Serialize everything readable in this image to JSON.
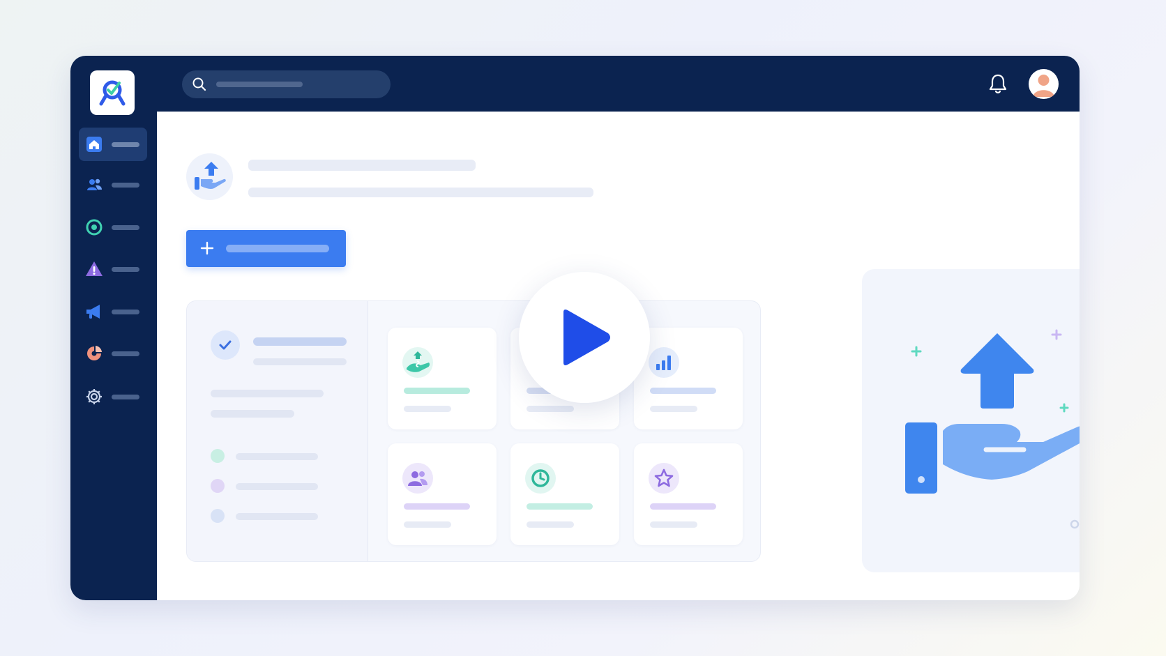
{
  "search": {
    "placeholder": ""
  },
  "sidebar": {
    "items": [
      {
        "icon": "home-icon",
        "active": true
      },
      {
        "icon": "users-icon",
        "active": false
      },
      {
        "icon": "target-icon",
        "active": false
      },
      {
        "icon": "warning-icon",
        "active": false
      },
      {
        "icon": "megaphone-icon",
        "active": false
      },
      {
        "icon": "pie-chart-icon",
        "active": false
      },
      {
        "icon": "gear-icon",
        "active": false
      }
    ]
  },
  "topbar": {
    "icons": [
      "bell-icon",
      "user-avatar"
    ]
  },
  "main": {
    "header_icon": "hand-upload-icon",
    "add_button_icon": "plus-icon",
    "cards": [
      {
        "icon": "hand-money-icon",
        "accent": "#5fd0c0"
      },
      {
        "icon": "hidden-icon",
        "accent": "#c7d2ee"
      },
      {
        "icon": "bar-chart-icon",
        "accent": "#9db8f4"
      },
      {
        "icon": "users-icon",
        "accent": "#b9a9ef"
      },
      {
        "icon": "clock-icon",
        "accent": "#a8e6db"
      },
      {
        "icon": "star-icon",
        "accent": "#c7b7f2"
      }
    ],
    "illustration": "hand-upload-illustration"
  },
  "colors": {
    "navy": "#0b2350",
    "primary_blue": "#3b7cf0",
    "play_blue": "#1f4de8",
    "teal": "#38c9a8",
    "purple": "#8d6be0"
  }
}
